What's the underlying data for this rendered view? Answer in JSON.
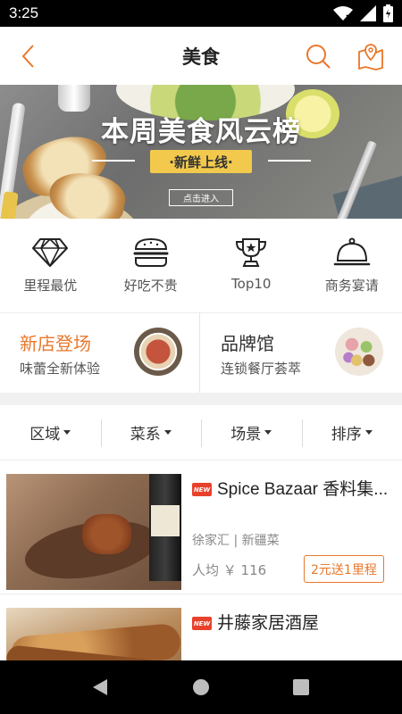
{
  "status_bar": {
    "time": "3:25"
  },
  "header": {
    "title": "美食"
  },
  "banner": {
    "headline": "本周美食风云榜",
    "ribbon": "·新鲜上线·",
    "button": "点击进入"
  },
  "categories": [
    {
      "label": "里程最优",
      "icon": "diamond-icon"
    },
    {
      "label": "好吃不贵",
      "icon": "burger-icon"
    },
    {
      "label": "Top10",
      "icon": "trophy-icon"
    },
    {
      "label": "商务宴请",
      "icon": "cloche-icon"
    }
  ],
  "promos": [
    {
      "title": "新店登场",
      "subtitle": "味蕾全新体验"
    },
    {
      "title": "品牌馆",
      "subtitle": "连锁餐厅荟萃"
    }
  ],
  "filters": [
    {
      "label": "区域"
    },
    {
      "label": "菜系"
    },
    {
      "label": "场景"
    },
    {
      "label": "排序"
    }
  ],
  "restaurants": [
    {
      "badge": "NEW",
      "name": "Spice Bazaar 香料集...",
      "area": "徐家汇 | 新疆菜",
      "avg_price": "人均 ￥ 116",
      "promo": "2元送1里程"
    },
    {
      "badge": "NEW",
      "name": "井藤家居酒屋"
    }
  ],
  "colors": {
    "accent": "#e9772c",
    "badge": "#e8412c",
    "ribbon": "#f2c94c"
  }
}
